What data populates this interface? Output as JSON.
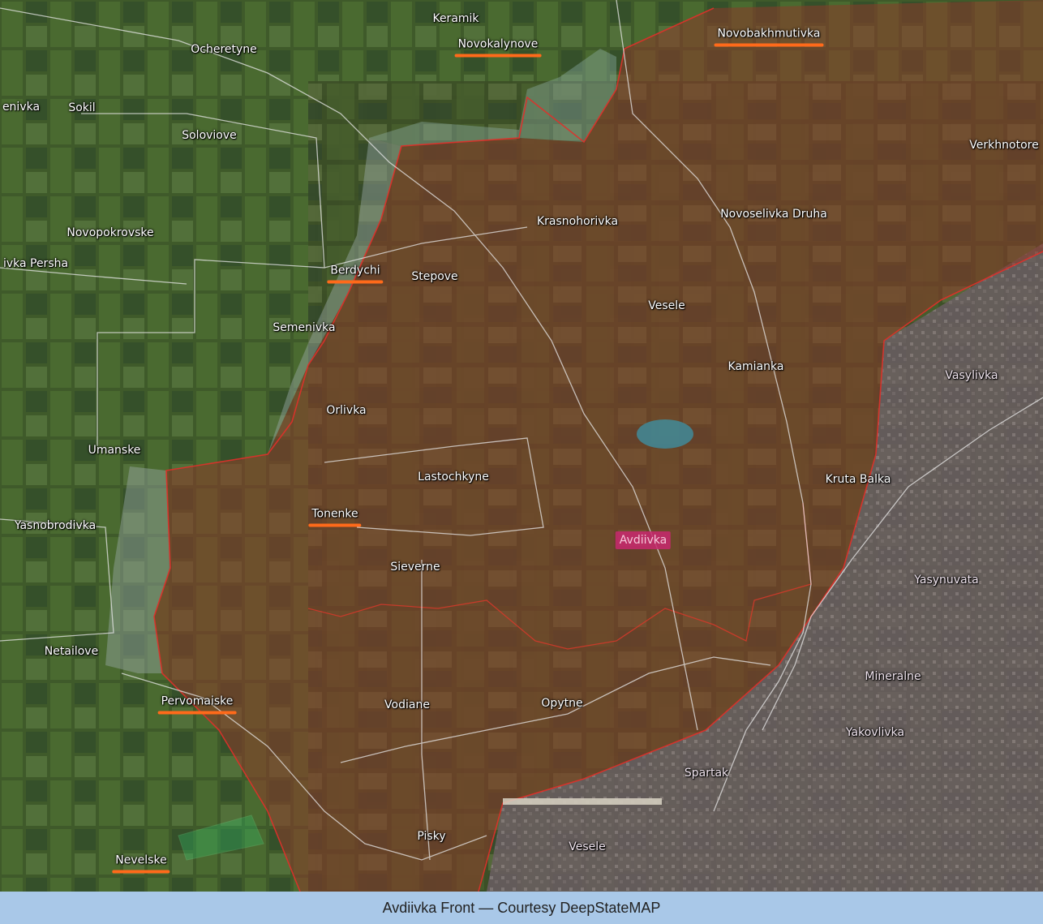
{
  "map": {
    "labels": [
      {
        "id": "keramik",
        "text": "Keramik",
        "style": "normal"
      },
      {
        "id": "novokalynove",
        "text": "Novokalynove",
        "style": "underlined"
      },
      {
        "id": "novobakhmutivka",
        "text": "Novobakhmutivka",
        "style": "underlined"
      },
      {
        "id": "ocheretyne",
        "text": "Ocheretyne",
        "style": "normal"
      },
      {
        "id": "semenivka-west",
        "text": "enivka",
        "style": "normal"
      },
      {
        "id": "sokil",
        "text": "Sokil",
        "style": "normal"
      },
      {
        "id": "soloviove",
        "text": "Soloviove",
        "style": "normal"
      },
      {
        "id": "verkhnotoretske",
        "text": "Verkhnotore",
        "style": "normal"
      },
      {
        "id": "krasnohorivka",
        "text": "Krasnohorivka",
        "style": "normal"
      },
      {
        "id": "novoselivka-druha",
        "text": "Novoselivka Druha",
        "style": "normal"
      },
      {
        "id": "novopokrovske",
        "text": "Novopokrovske",
        "style": "normal"
      },
      {
        "id": "novoselivka-persha",
        "text": "ivka Persha",
        "style": "normal"
      },
      {
        "id": "berdychi",
        "text": "Berdychi",
        "style": "underlined"
      },
      {
        "id": "stepove",
        "text": "Stepove",
        "style": "normal"
      },
      {
        "id": "vesele-north",
        "text": "Vesele",
        "style": "normal"
      },
      {
        "id": "semenivka",
        "text": "Semenivka",
        "style": "normal"
      },
      {
        "id": "kamianka",
        "text": "Kamianka",
        "style": "normal"
      },
      {
        "id": "vasylivka",
        "text": "Vasylivka",
        "style": "urban"
      },
      {
        "id": "orlivka",
        "text": "Orlivka",
        "style": "normal"
      },
      {
        "id": "umanske",
        "text": "Umanske",
        "style": "normal"
      },
      {
        "id": "lastochkyne",
        "text": "Lastochkyne",
        "style": "normal"
      },
      {
        "id": "kruta-balka",
        "text": "Kruta Balka",
        "style": "normal"
      },
      {
        "id": "tonenke",
        "text": "Tonenke",
        "style": "underlined"
      },
      {
        "id": "yasnobrodivka",
        "text": "Yasnobrodivka",
        "style": "normal"
      },
      {
        "id": "avdiivka",
        "text": "Avdiivka",
        "style": "highlight"
      },
      {
        "id": "sieverne",
        "text": "Sieverne",
        "style": "normal"
      },
      {
        "id": "yasynuvata",
        "text": "Yasynuvata",
        "style": "urban"
      },
      {
        "id": "netailove",
        "text": "Netailove",
        "style": "normal"
      },
      {
        "id": "mineralne",
        "text": "Mineralne",
        "style": "urban"
      },
      {
        "id": "pervomaiske",
        "text": "Pervomaiske",
        "style": "underlined"
      },
      {
        "id": "vodiane",
        "text": "Vodiane",
        "style": "normal"
      },
      {
        "id": "opytne",
        "text": "Opytne",
        "style": "normal"
      },
      {
        "id": "yakovlivka",
        "text": "Yakovlivka",
        "style": "urban"
      },
      {
        "id": "spartak",
        "text": "Spartak",
        "style": "urban"
      },
      {
        "id": "pisky",
        "text": "Pisky",
        "style": "normal"
      },
      {
        "id": "vesele-south",
        "text": "Vesele",
        "style": "urban"
      },
      {
        "id": "nevelske",
        "text": "Nevelske",
        "style": "underlined"
      }
    ],
    "colors": {
      "occupied_fill": "#8a3a2a",
      "frontline": "#e0302a",
      "contested_fill": "#9aa9a6",
      "liberated_fill": "#2ecc71",
      "underline": "#ff6a1a",
      "highlight": "#c8286e"
    }
  },
  "caption": {
    "text": "Avdiivka Front — Courtesy DeepStateMAP"
  }
}
